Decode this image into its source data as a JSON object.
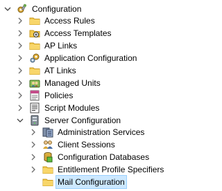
{
  "tree": {
    "root": {
      "label": "Configuration",
      "icon": "configuration-icon",
      "expanded": true
    },
    "level1": [
      {
        "label": "Access Rules",
        "icon": "folder-icon"
      },
      {
        "label": "Access Templates",
        "icon": "access-templates-icon"
      },
      {
        "label": "AP Links",
        "icon": "folder-icon"
      },
      {
        "label": "Application Configuration",
        "icon": "application-configuration-icon"
      },
      {
        "label": "AT Links",
        "icon": "folder-icon"
      },
      {
        "label": "Managed Units",
        "icon": "managed-units-icon"
      },
      {
        "label": "Policies",
        "icon": "policies-icon"
      },
      {
        "label": "Script Modules",
        "icon": "script-modules-icon"
      },
      {
        "label": "Server Configuration",
        "icon": "server-configuration-icon",
        "expanded": true
      }
    ],
    "level2": [
      {
        "label": "Administration Services",
        "icon": "administration-services-icon"
      },
      {
        "label": "Client Sessions",
        "icon": "client-sessions-icon"
      },
      {
        "label": "Configuration Databases",
        "icon": "configuration-databases-icon"
      },
      {
        "label": "Entitlement Profile Specifiers",
        "icon": "folder-icon"
      },
      {
        "label": "Mail Configuration",
        "icon": "folder-icon",
        "selected": true
      }
    ]
  },
  "colors": {
    "selection": "#cce8ff",
    "folder": "#f3c94b",
    "chevron": "#6b6b6b"
  }
}
